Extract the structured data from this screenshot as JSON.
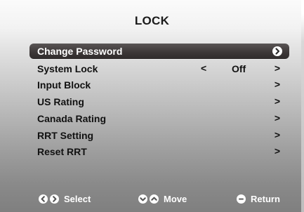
{
  "title": "LOCK",
  "menu": [
    {
      "label": "Change Password",
      "arrow": ">",
      "selected": true
    },
    {
      "label": "System Lock",
      "left_arrow": "<",
      "value": "Off",
      "arrow": ">"
    },
    {
      "label": "Input Block",
      "arrow": ">"
    },
    {
      "label": "US Rating",
      "arrow": ">"
    },
    {
      "label": "Canada Rating",
      "arrow": ">"
    },
    {
      "label": "RRT Setting",
      "arrow": ">"
    },
    {
      "label": "Reset RRT",
      "arrow": ">"
    }
  ],
  "footer": {
    "select_label": "Select",
    "move_label": "Move",
    "return_label": "Return"
  },
  "colors": {
    "highlight": "#3d3838",
    "text": "#111111",
    "footer_text": "#ffffff"
  }
}
